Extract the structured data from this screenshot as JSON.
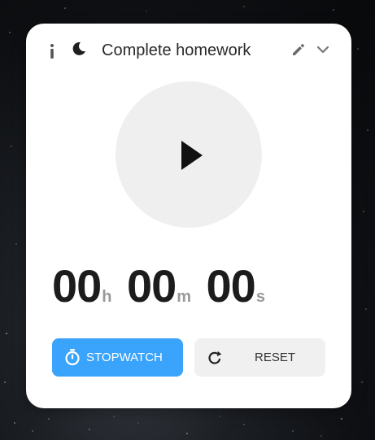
{
  "task": {
    "title": "Complete homework"
  },
  "header": {
    "info_icon": "info-icon",
    "moon_icon": "moon-icon",
    "edit_icon": "pencil-icon",
    "collapse_icon": "chevron-down-icon"
  },
  "player": {
    "icon": "play-icon",
    "accent": "#efefef"
  },
  "time": {
    "hours": "00",
    "hours_unit": "h",
    "minutes": "00",
    "minutes_unit": "m",
    "seconds": "00",
    "seconds_unit": "s"
  },
  "buttons": {
    "stopwatch_label": "STOPWATCH",
    "stopwatch_icon": "stopwatch-icon",
    "stopwatch_color": "#3aa3fb",
    "reset_label": "RESET",
    "reset_icon": "reset-icon",
    "reset_color": "#f0f0f0"
  }
}
